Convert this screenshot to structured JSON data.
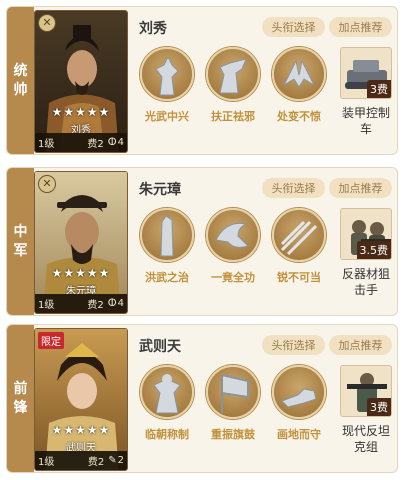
{
  "buttons": {
    "title_select": "头衔选择",
    "recommend": "加点推荐"
  },
  "cards": [
    {
      "role": "统帅",
      "hero_name": "刘秀",
      "portrait_label": "刘秀",
      "stars": "★★★★★",
      "badge": "",
      "level": "1级",
      "cost": "费2",
      "slot_icon": "ⵀ",
      "slot_count": "4",
      "skills": [
        "光武中兴",
        "扶正祛邪",
        "处变不惊"
      ],
      "equip": {
        "cost": "3费",
        "name": "装甲控制车"
      }
    },
    {
      "role": "中军",
      "hero_name": "朱元璋",
      "portrait_label": "朱元璋",
      "stars": "★★★★★",
      "badge": "",
      "level": "1级",
      "cost": "费2",
      "slot_icon": "ⵀ",
      "slot_count": "4",
      "skills": [
        "洪武之治",
        "一竟全功",
        "锐不可当"
      ],
      "equip": {
        "cost": "3.5费",
        "name": "反器材狙击手"
      }
    },
    {
      "role": "前锋",
      "hero_name": "武则天",
      "portrait_label": "武则天",
      "stars": "★★★★★",
      "badge": "限定",
      "level": "1级",
      "cost": "费2",
      "slot_icon": "✎",
      "slot_count": "2",
      "skills": [
        "临朝称制",
        "重振旗鼓",
        "画地而守"
      ],
      "equip": {
        "cost": "3费",
        "name": "现代反坦克组"
      }
    }
  ]
}
